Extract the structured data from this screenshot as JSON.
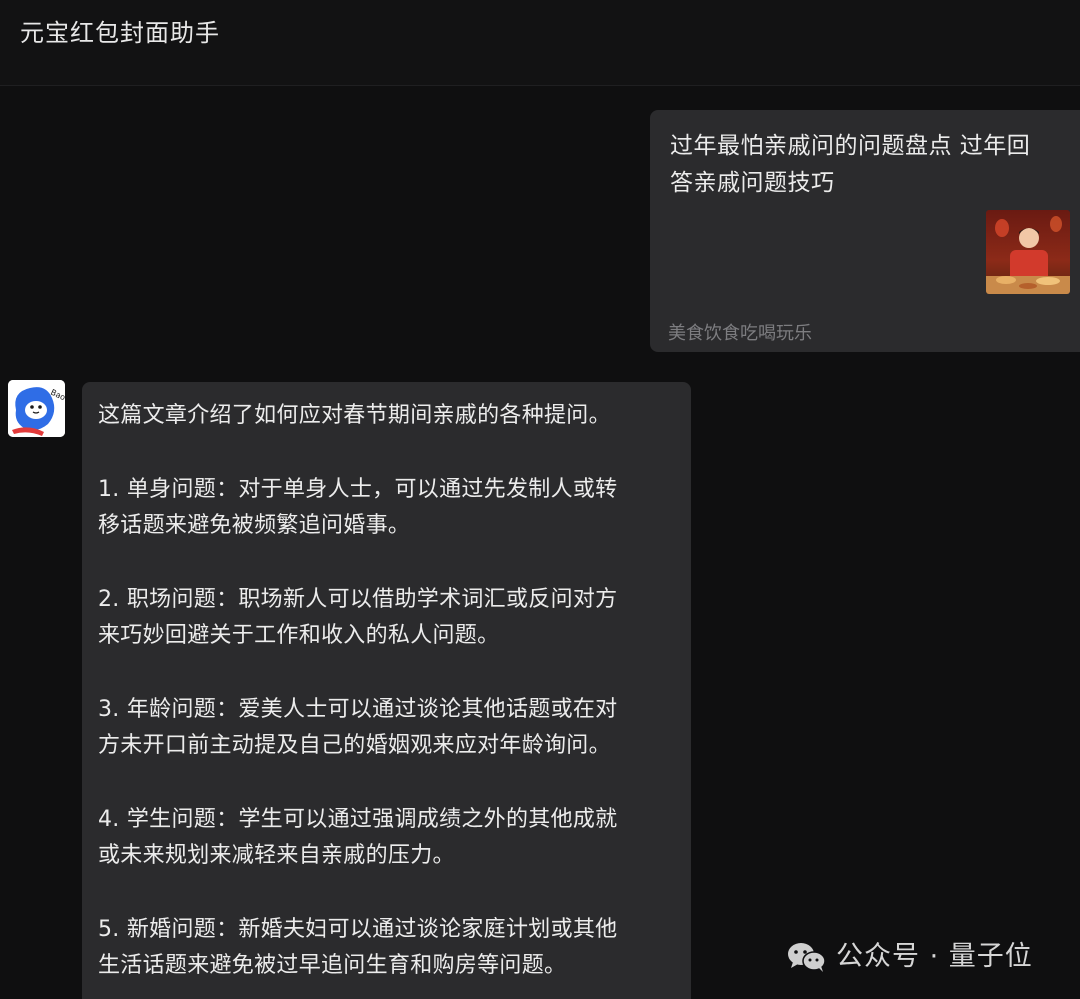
{
  "header": {
    "title": "元宝红包封面助手"
  },
  "user_message": {
    "title_line1": "过年最怕亲戚问的问题盘点 过年回",
    "title_line2": "答亲戚问题技巧",
    "source": "美食饮食吃喝玩乐",
    "thumbnail_icon": "article-thumbnail"
  },
  "bot": {
    "avatar_label": "Bao",
    "lines": [
      "这篇文章介绍了如何应对春节期间亲戚的各种提问。",
      "  1. 单身问题：对于单身人士，可以通过先发制人或转",
      "移话题来避免被频繁追问婚事。",
      "  2. 职场问题：职场新人可以借助学术词汇或反问对方",
      "来巧妙回避关于工作和收入的私人问题。",
      "  3. 年龄问题：爱美人士可以通过谈论其他话题或在对",
      "方未开口前主动提及自己的婚姻观来应对年龄询问。",
      "  4. 学生问题：学生可以通过强调成绩之外的其他成就",
      "或未来规划来减轻来自亲戚的压力。",
      "  5. 新婚问题：新婚夫妇可以通过谈论家庭计划或其他",
      "生活话题来避免被过早追问生育和购房等问题。"
    ]
  },
  "watermark": {
    "text": "公众号 · 量子位",
    "icon": "wechat-icon"
  },
  "colors": {
    "background": "#0f0f10",
    "bubble": "#2b2b2d",
    "text": "#ececec",
    "muted": "#7d7d80"
  }
}
